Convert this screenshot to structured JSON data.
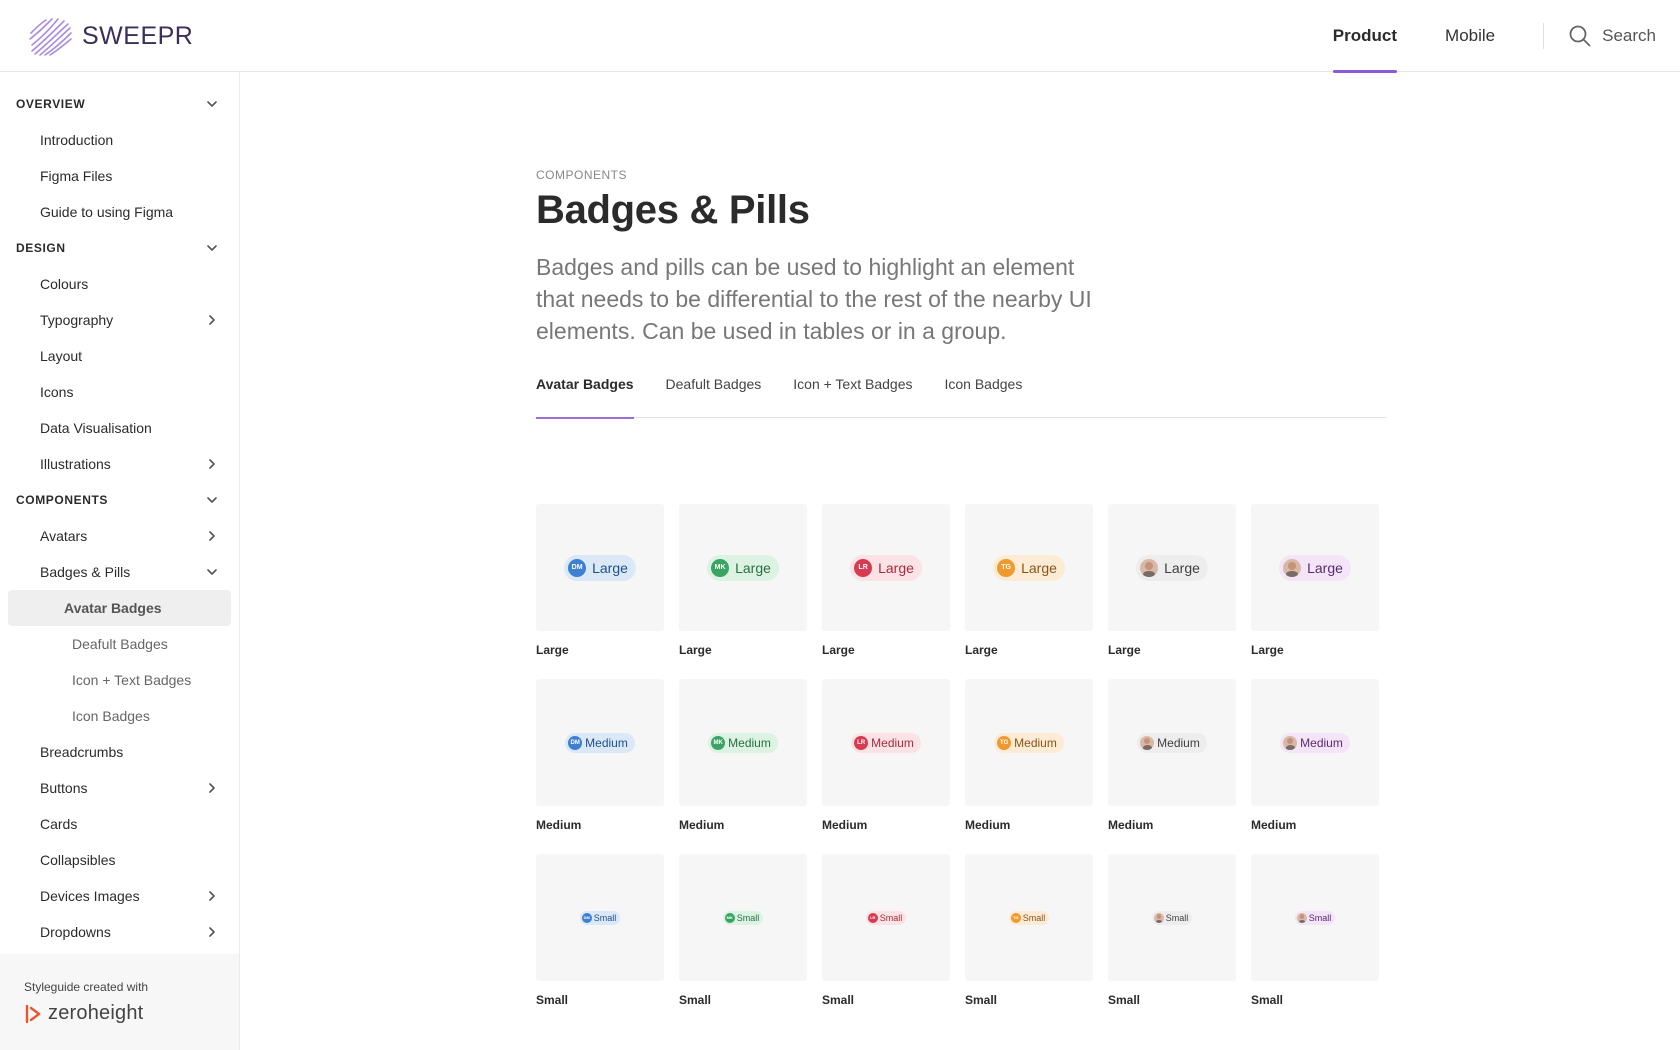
{
  "brand": {
    "name": "SWEEPR",
    "accent": "#8c5bd6"
  },
  "topnav": {
    "items": [
      "Product",
      "Mobile"
    ],
    "active": "Product",
    "search_label": "Search"
  },
  "sidebar": {
    "sections": [
      {
        "label": "OVERVIEW",
        "items": [
          {
            "label": "Introduction"
          },
          {
            "label": "Figma Files"
          },
          {
            "label": "Guide to using Figma"
          }
        ]
      },
      {
        "label": "DESIGN",
        "items": [
          {
            "label": "Colours"
          },
          {
            "label": "Typography"
          },
          {
            "label": "Layout"
          },
          {
            "label": "Icons"
          },
          {
            "label": "Data Visualisation"
          },
          {
            "label": "Illustrations"
          }
        ]
      },
      {
        "label": "COMPONENTS",
        "items": [
          {
            "label": "Avatars"
          },
          {
            "label": "Badges & Pills",
            "children": [
              "Avatar Badges",
              "Deafult Badges",
              "Icon + Text Badges",
              "Icon Badges"
            ]
          },
          {
            "label": "Breadcrumbs"
          },
          {
            "label": "Buttons"
          },
          {
            "label": "Cards"
          },
          {
            "label": "Collapsibles"
          },
          {
            "label": "Devices Images"
          },
          {
            "label": "Dropdowns"
          }
        ]
      }
    ],
    "footer": {
      "caption": "Styleguide created with",
      "product": "zeroheight"
    }
  },
  "page": {
    "eyebrow": "COMPONENTS",
    "title": "Badges & Pills",
    "lead": "Badges and pills can be used to highlight an element that needs to be differential to the rest of the nearby UI elements. Can be used in tables or in a group.",
    "tabs": [
      "Avatar Badges",
      "Deafult Badges",
      "Icon + Text Badges",
      "Icon Badges"
    ],
    "active_tab": "Avatar Badges"
  },
  "badge_colors": [
    {
      "initials": "DM",
      "bg": "#dbe8f7",
      "avatar": "#3d7fd0",
      "text": "#1f4f8c"
    },
    {
      "initials": "MK",
      "bg": "#dcf2e3",
      "avatar": "#3aa563",
      "text": "#2a6f45"
    },
    {
      "initials": "LR",
      "bg": "#fbe3e5",
      "avatar": "#d83a52",
      "text": "#a82b3e"
    },
    {
      "initials": "TG",
      "bg": "#fcebd5",
      "avatar": "#f0992e",
      "text": "#8a5517"
    },
    {
      "initials": "",
      "bg": "#ededed",
      "avatar": "photo",
      "text": "#3f3f3f"
    },
    {
      "initials": "",
      "bg": "#f3e4f7",
      "avatar": "photo",
      "text": "#5a2b72"
    }
  ],
  "sizes": [
    {
      "key": "large",
      "label": "Large"
    },
    {
      "key": "medium",
      "label": "Medium"
    },
    {
      "key": "small",
      "label": "Small"
    }
  ]
}
